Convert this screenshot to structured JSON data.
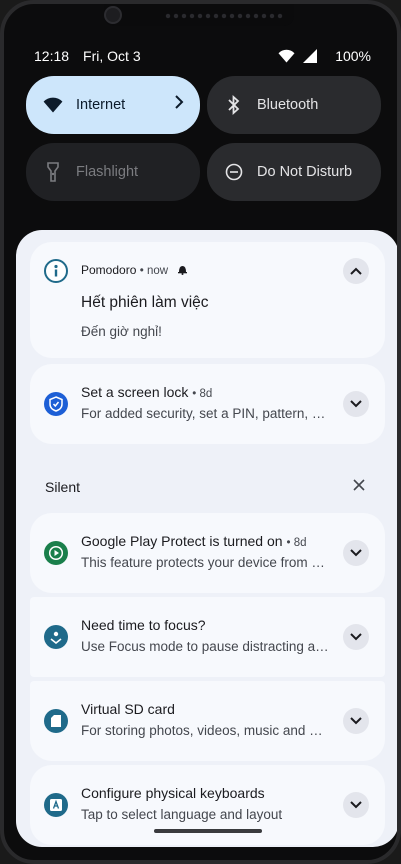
{
  "status_bar": {
    "time": "12:18",
    "date": "Fri, Oct 3",
    "battery": "100%",
    "icons": [
      "wifi-icon",
      "signal-icon"
    ]
  },
  "quick_settings": [
    {
      "label": "Internet",
      "state": "active",
      "icon": "wifi-icon"
    },
    {
      "label": "Bluetooth",
      "state": "inactive",
      "icon": "bluetooth-icon"
    },
    {
      "label": "Flashlight",
      "state": "unavailable",
      "icon": "flashlight-icon"
    },
    {
      "label": "Do Not Disturb",
      "state": "inactive",
      "icon": "do-not-disturb-icon"
    }
  ],
  "notifications": [
    {
      "app": "Pomodoro",
      "time": "now",
      "title": "Hết phiên làm việc",
      "body": "Đến giờ nghỉ!",
      "expanded": true,
      "icon": "info-icon",
      "accent": "#1f6a8a"
    },
    {
      "title": "Set a screen lock",
      "time": "8d",
      "body": "For added security, set a PIN, pattern, or password",
      "icon": "shield-icon",
      "accent": "#1d5fd6"
    }
  ],
  "silent_section": {
    "label": "Silent",
    "items": [
      {
        "title": "Google Play Protect is turned on",
        "time": "8d",
        "body": "This feature protects your device from harmful apps",
        "icon": "play-protect-icon",
        "accent": "#1a7f4b"
      },
      {
        "title": "Need time to focus?",
        "body": "Use Focus mode to pause distracting apps",
        "icon": "focus-icon",
        "accent": "#1f6a8a"
      },
      {
        "title": "Virtual SD card",
        "body": "For storing photos, videos, music and more",
        "icon": "sd-card-icon",
        "accent": "#1f6a8a"
      },
      {
        "title": "Configure physical keyboards",
        "body": "Tap to select language and layout",
        "icon": "keyboard-icon",
        "accent": "#1f6a8a"
      }
    ]
  },
  "colors": {
    "shade_bg": "#eef1f8",
    "card_bg": "#f7f9fd",
    "tile_active": "#cde6fb"
  }
}
